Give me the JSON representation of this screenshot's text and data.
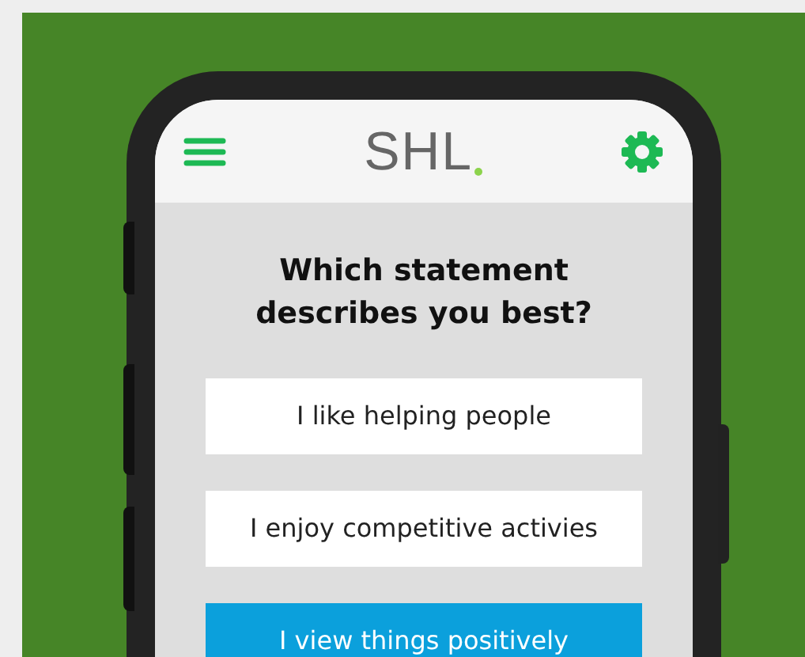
{
  "header": {
    "logo": "SHL"
  },
  "question": "Which statement describes you best?",
  "options": [
    {
      "label": "I like helping people",
      "selected": false
    },
    {
      "label": "I enjoy competitive activies",
      "selected": false
    },
    {
      "label": "I view things positively",
      "selected": true
    }
  ]
}
